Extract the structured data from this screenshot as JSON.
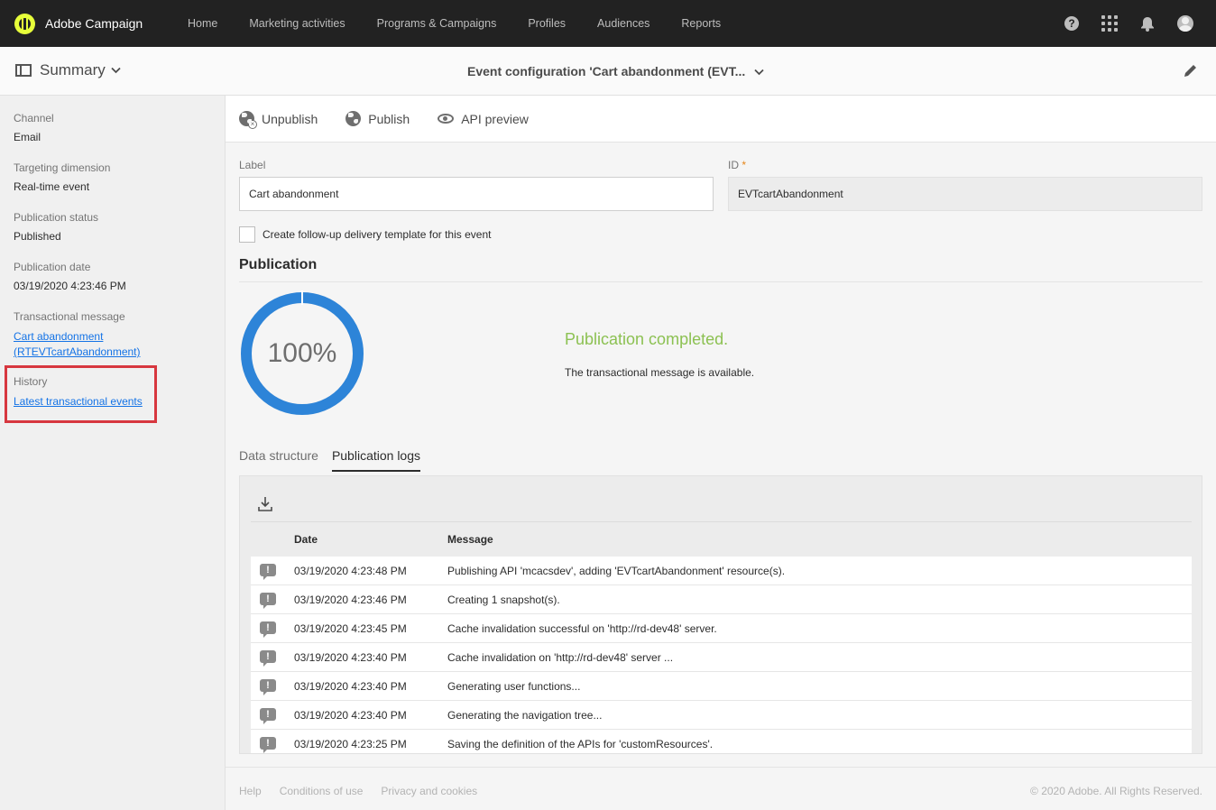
{
  "app": {
    "name": "Adobe Campaign",
    "nav": [
      "Home",
      "Marketing activities",
      "Programs & Campaigns",
      "Profiles",
      "Audiences",
      "Reports"
    ],
    "icons": [
      "help-icon",
      "apps-grid-icon",
      "bell-icon",
      "avatar"
    ]
  },
  "header": {
    "summary_label": "Summary",
    "title": "Event configuration 'Cart abandonment (EVT..."
  },
  "sidebar": {
    "channel_label": "Channel",
    "channel_value": "Email",
    "targeting_label": "Targeting dimension",
    "targeting_value": "Real-time event",
    "status_label": "Publication status",
    "status_value": "Published",
    "date_label": "Publication date",
    "date_value": "03/19/2020 4:23:46 PM",
    "tm_label": "Transactional message",
    "tm_link_line1": "Cart abandonment",
    "tm_link_line2": "(RTEVTcartAbandonment)",
    "history_label": "History",
    "history_link": "Latest transactional events"
  },
  "toolbar": {
    "unpublish": "Unpublish",
    "publish": "Publish",
    "api_preview": "API preview"
  },
  "form": {
    "label_caption": "Label",
    "label_value": "Cart abandonment",
    "id_caption": "ID",
    "id_required": "*",
    "id_value": "EVTcartAbandonment",
    "followup_label": "Create follow-up delivery template for this event"
  },
  "publication": {
    "title": "Publication",
    "progress_text": "100%",
    "progress_value": 100,
    "status": "Publication completed.",
    "detail": "The transactional message is available.",
    "ring_color": "#2d84d8",
    "status_color": "#8cc152"
  },
  "tabs": [
    "Data structure",
    "Publication logs"
  ],
  "logs": {
    "col_date": "Date",
    "col_message": "Message",
    "rows": [
      {
        "date": "03/19/2020 4:23:48 PM",
        "message": "Publishing API 'mcacsdev', adding 'EVTcartAbandonment' resource(s)."
      },
      {
        "date": "03/19/2020 4:23:46 PM",
        "message": "Creating 1 snapshot(s)."
      },
      {
        "date": "03/19/2020 4:23:45 PM",
        "message": "Cache invalidation successful on 'http://rd-dev48' server."
      },
      {
        "date": "03/19/2020 4:23:40 PM",
        "message": "Cache invalidation on 'http://rd-dev48' server ..."
      },
      {
        "date": "03/19/2020 4:23:40 PM",
        "message": "Generating user functions..."
      },
      {
        "date": "03/19/2020 4:23:40 PM",
        "message": "Generating the navigation tree..."
      },
      {
        "date": "03/19/2020 4:23:25 PM",
        "message": "Saving the definition of the APIs for 'customResources'."
      }
    ]
  },
  "footer": {
    "links": [
      "Help",
      "Conditions of use",
      "Privacy and cookies"
    ],
    "copyright": "© 2020 Adobe. All Rights Reserved."
  }
}
